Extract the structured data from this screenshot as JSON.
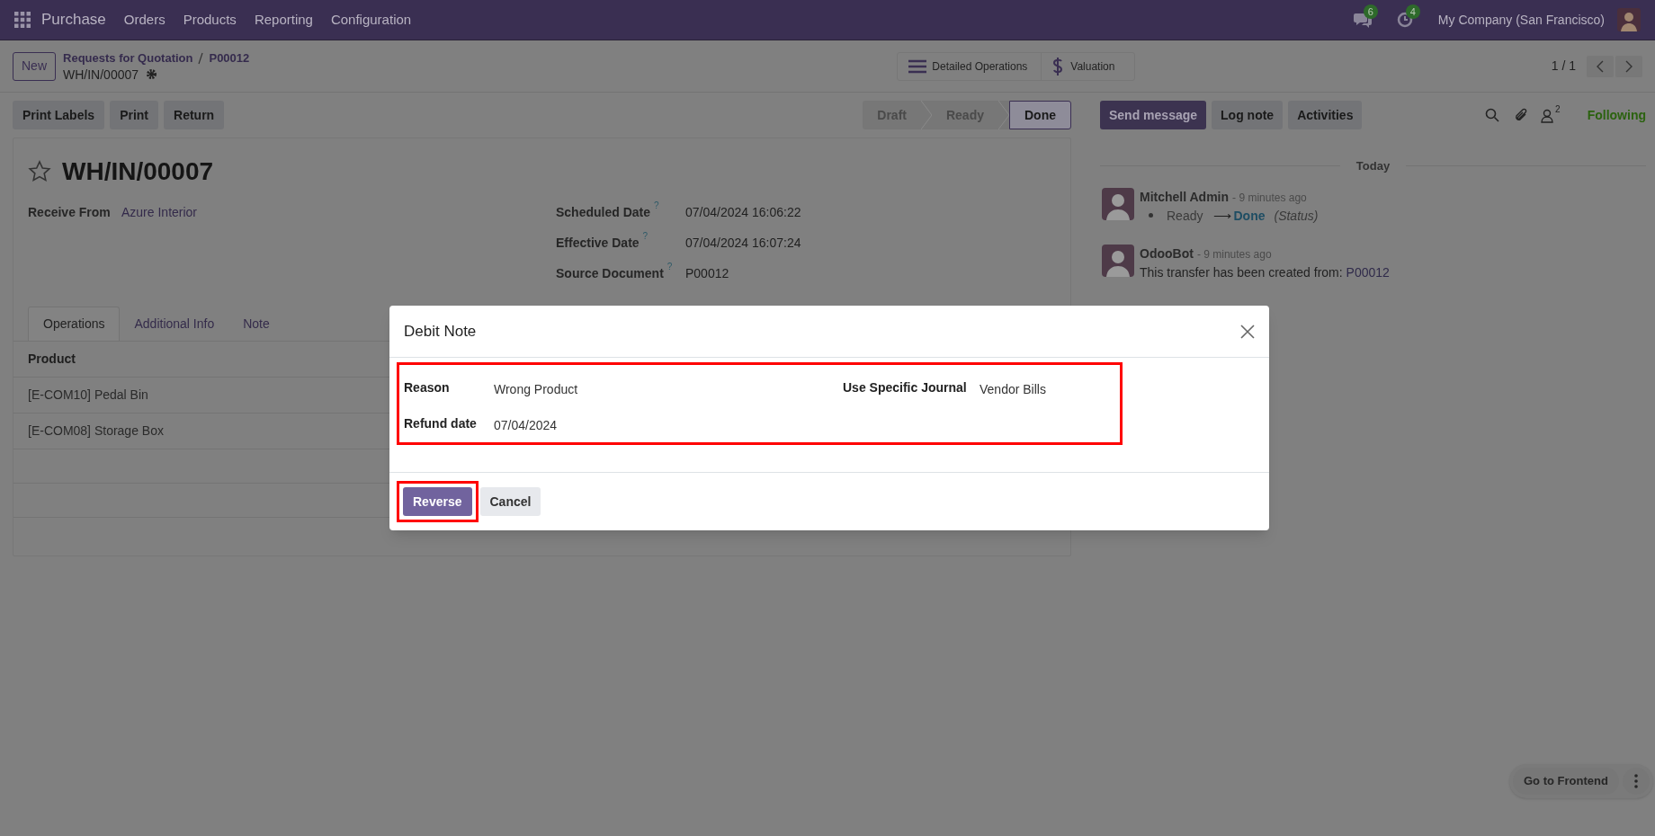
{
  "navbar": {
    "app": "Purchase",
    "menu": [
      "Orders",
      "Products",
      "Reporting",
      "Configuration"
    ],
    "messages_count": "6",
    "activities_count": "4",
    "company": "My Company (San Francisco)"
  },
  "control_panel": {
    "new_button": "New",
    "breadcrumb": [
      "Requests for Quotation",
      "P00012"
    ],
    "record": "WH/IN/00007",
    "smart_buttons": [
      {
        "kind": "list",
        "label": "Detailed Operations"
      },
      {
        "kind": "dollar",
        "label": "Valuation"
      }
    ],
    "pager": "1 / 1"
  },
  "actions": [
    "Print Labels",
    "Print",
    "Return"
  ],
  "status_stages": [
    {
      "label": "Draft",
      "selected": false
    },
    {
      "label": "Ready",
      "selected": false
    },
    {
      "label": "Done",
      "selected": true
    }
  ],
  "form": {
    "title": "WH/IN/00007",
    "starred": false,
    "left_fields": [
      {
        "label": "Receive From",
        "value": "Azure Interior",
        "link": true
      }
    ],
    "right_fields": [
      {
        "label": "Scheduled Date",
        "help": "?",
        "value": "07/04/2024 16:06:22"
      },
      {
        "label": "Effective Date",
        "help": "?",
        "value": "07/04/2024 16:07:24"
      },
      {
        "label": "Source Document",
        "help": "?",
        "value": "P00012"
      }
    ],
    "tabs": [
      {
        "label": "Operations",
        "selected": true
      },
      {
        "label": "Additional Info",
        "selected": false
      },
      {
        "label": "Note",
        "selected": false
      }
    ],
    "table": {
      "columns": [
        "Product"
      ],
      "rows": [
        [
          "[E-COM10] Pedal Bin"
        ],
        [
          "[E-COM08] Storage Box"
        ]
      ]
    }
  },
  "chatter": {
    "buttons": [
      {
        "label": "Send message",
        "kind": "primary"
      },
      {
        "label": "Log note",
        "kind": "secondary"
      },
      {
        "label": "Activities",
        "kind": "secondary"
      }
    ],
    "followers_count": "2",
    "follow_label": "Following",
    "day": "Today",
    "messages": [
      {
        "kind": "tracking",
        "author": "Mitchell Admin",
        "time": "- 9 minutes ago",
        "old": "Ready",
        "arrow": "⟶",
        "new": "Done",
        "field": "(Status)"
      },
      {
        "kind": "text",
        "author": "OdooBot",
        "time": "- 9 minutes ago",
        "body": "This transfer has been created from: ",
        "link": "P00012"
      }
    ]
  },
  "dialog": {
    "title": "Debit Note",
    "body_highlighted": true,
    "left_fields": [
      {
        "label": "Reason",
        "value": "Wrong Product"
      },
      {
        "label": "Refund date",
        "value": "07/04/2024"
      }
    ],
    "right_fields": [
      {
        "label": "Use Specific Journal",
        "value": "Vendor Bills"
      }
    ],
    "buttons": [
      {
        "label": "Reverse",
        "kind": "primary",
        "highlighted": true
      },
      {
        "label": "Cancel",
        "kind": "secondary",
        "highlighted": false
      }
    ]
  },
  "frontend_button": "Go to Frontend"
}
